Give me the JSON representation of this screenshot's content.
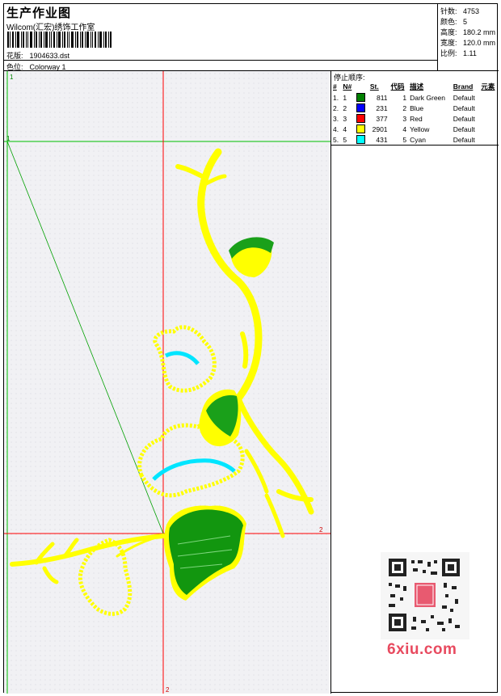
{
  "header": {
    "title": "生产作业图",
    "company": "Wilcom(汇宏)绣饰工作室",
    "design_label": "花版:",
    "design_value": "1904633.dst",
    "colorway_label": "色位:",
    "colorway_value": "Colorway 1"
  },
  "stats": {
    "stitches_label": "针数:",
    "stitches_value": "4753",
    "colors_label": "颜色:",
    "colors_value": "5",
    "height_label": "高度:",
    "height_value": "180.2 mm",
    "width_label": "宽度:",
    "width_value": "120.0 mm",
    "scale_label": "比例:",
    "scale_value": "1.11"
  },
  "stop_sequence": {
    "title": "停止顺序:",
    "columns": [
      "#",
      "N#",
      "St.",
      "代码",
      "描述",
      "Brand",
      "元素"
    ],
    "rows": [
      {
        "idx": "1.",
        "n": "1",
        "color": "#008000",
        "st": "811",
        "code": "1",
        "desc": "Dark Green",
        "brand": "Default"
      },
      {
        "idx": "2.",
        "n": "2",
        "color": "#0000ff",
        "st": "231",
        "code": "2",
        "desc": "Blue",
        "brand": "Default"
      },
      {
        "idx": "3.",
        "n": "3",
        "color": "#ff0000",
        "st": "377",
        "code": "3",
        "desc": "Red",
        "brand": "Default"
      },
      {
        "idx": "4.",
        "n": "4",
        "color": "#ffff00",
        "st": "2901",
        "code": "4",
        "desc": "Yellow",
        "brand": "Default"
      },
      {
        "idx": "5.",
        "n": "5",
        "color": "#00ffff",
        "st": "431",
        "code": "5",
        "desc": "Cyan",
        "brand": "Default"
      }
    ]
  },
  "canvas": {
    "marker_v1": "1",
    "marker_h1": "1",
    "marker_h2": "2",
    "marker_v2": "2",
    "colors": {
      "yellow": "#ffff00",
      "green": "#008000",
      "cyan": "#00e5ff",
      "red": "#ff0000",
      "guide": "#00c000"
    }
  },
  "watermark": "6xiu.com"
}
